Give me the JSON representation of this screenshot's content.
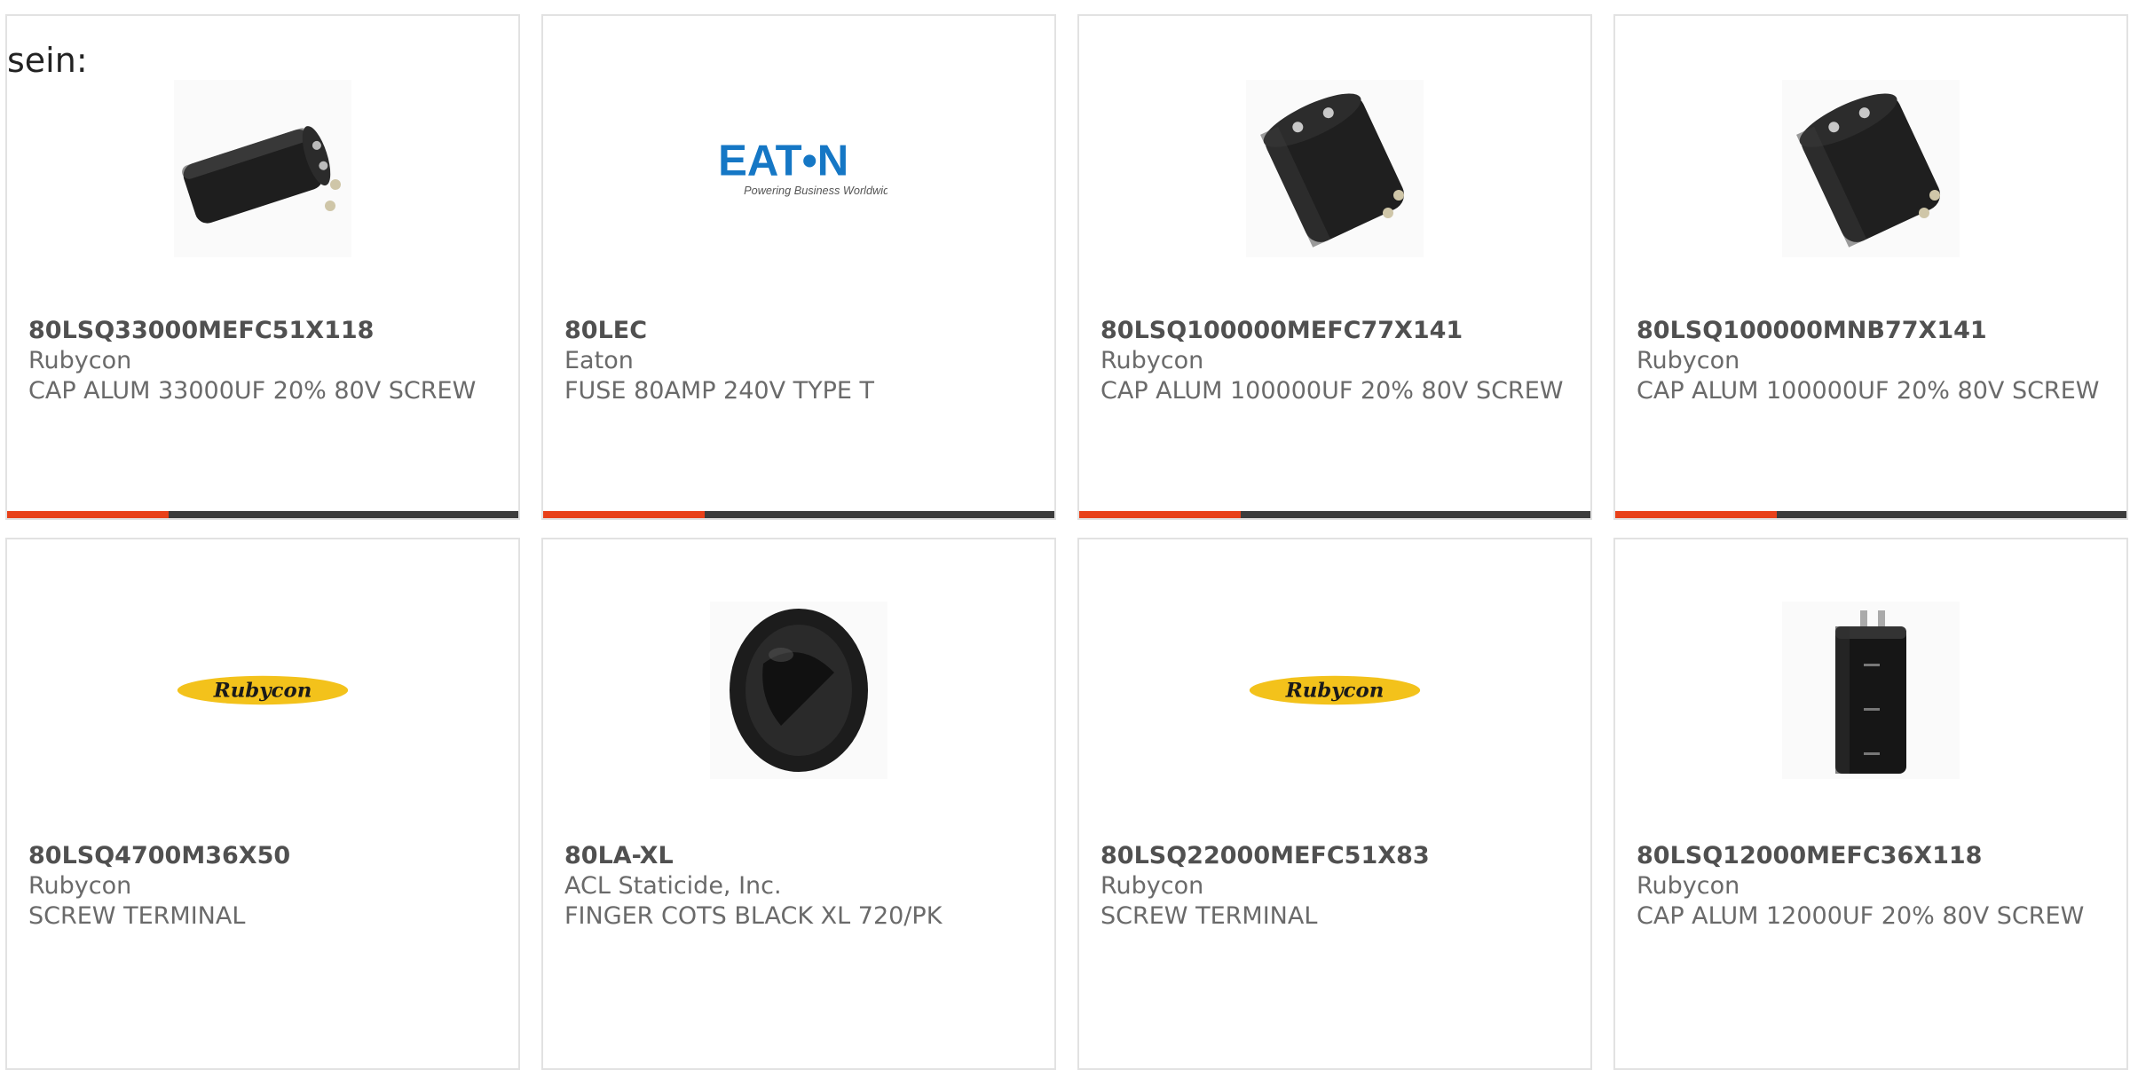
{
  "lead_text": "sein:",
  "colors": {
    "accent": "#e8411a",
    "bar": "#3c3c3c",
    "eaton_blue": "#1577c5",
    "rubycon_yellow": "#f3c21b"
  },
  "products": [
    {
      "part_number": "80LSQ33000MEFC51X118",
      "manufacturer": "Rubycon",
      "description": "CAP ALUM 33000UF 20% 80V SCREW",
      "image": "capacitor-horizontal-icon"
    },
    {
      "part_number": "80LEC",
      "manufacturer": "Eaton",
      "description": "FUSE 80AMP 240V TYPE T",
      "image": "eaton-logo",
      "logo_text": "EAT•N",
      "logo_tagline": "Powering Business Worldwide"
    },
    {
      "part_number": "80LSQ100000MEFC77X141",
      "manufacturer": "Rubycon",
      "description": "CAP ALUM 100000UF 20% 80V SCREW",
      "image": "capacitor-large-icon"
    },
    {
      "part_number": "80LSQ100000MNB77X141",
      "manufacturer": "Rubycon",
      "description": "CAP ALUM 100000UF 20% 80V SCREW",
      "image": "capacitor-large-icon"
    },
    {
      "part_number": "80LSQ4700M36X50",
      "manufacturer": "Rubycon",
      "description": "SCREW TERMINAL",
      "image": "rubycon-logo",
      "logo_text": "Rubycon"
    },
    {
      "part_number": "80LA-XL",
      "manufacturer": "ACL Staticide, Inc.",
      "description": "FINGER COTS BLACK XL 720/PK",
      "image": "finger-cot-icon"
    },
    {
      "part_number": "80LSQ22000MEFC51X83",
      "manufacturer": "Rubycon",
      "description": "SCREW TERMINAL",
      "image": "rubycon-logo",
      "logo_text": "Rubycon"
    },
    {
      "part_number": "80LSQ12000MEFC36X118",
      "manufacturer": "Rubycon",
      "description": "CAP ALUM 12000UF 20% 80V SCREW",
      "image": "capacitor-upright-icon"
    }
  ]
}
